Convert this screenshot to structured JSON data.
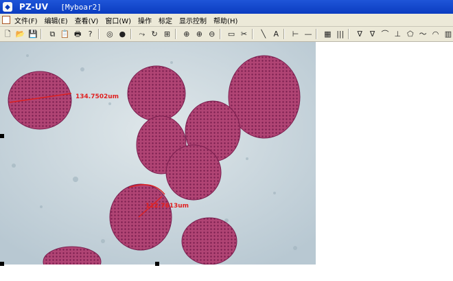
{
  "app": {
    "title": "PZ-UV",
    "document_title": "[Myboar2]"
  },
  "menu": {
    "items": [
      "文件(F)",
      "编辑(E)",
      "查看(V)",
      "窗口(W)",
      "操作",
      "标定",
      "显示控制",
      "帮助(H)"
    ]
  },
  "toolbar": {
    "groups": [
      [
        "new-file-icon",
        "open-folder-icon",
        "save-icon"
      ],
      [
        "copy-icon",
        "paste-icon",
        "print-icon",
        "help-icon"
      ],
      [
        "circle-outline-icon",
        "filled-circle-icon"
      ],
      [
        "calibrate-icon",
        "rotate-icon",
        "grid-icon"
      ],
      [
        "zoom-fit-icon",
        "zoom-in-icon",
        "zoom-out-icon"
      ],
      [
        "rectangle-icon",
        "tool-icon"
      ],
      [
        "line-icon",
        "text-icon"
      ],
      [
        "dimension-icon",
        "horizontal-line-icon"
      ],
      [
        "color-palette-icon",
        "bars-icon"
      ],
      [
        "angle-tool-icon",
        "angle-tool-2-icon",
        "arc-tool-icon",
        "baseline-icon",
        "polygon-tool-icon",
        "curve-tool-icon",
        "protractor-icon",
        "histogram-icon"
      ]
    ],
    "glyphs": {
      "new-file-icon": "🗋",
      "open-folder-icon": "📂",
      "save-icon": "💾",
      "copy-icon": "⧉",
      "paste-icon": "📋",
      "print-icon": "🖶",
      "help-icon": "?",
      "circle-outline-icon": "◎",
      "filled-circle-icon": "●",
      "calibrate-icon": "⤳",
      "rotate-icon": "↻",
      "grid-icon": "⊞",
      "zoom-fit-icon": "⊕",
      "zoom-in-icon": "⊕",
      "zoom-out-icon": "⊖",
      "rectangle-icon": "▭",
      "tool-icon": "✂",
      "line-icon": "╲",
      "text-icon": "A",
      "dimension-icon": "⊢",
      "horizontal-line-icon": "—",
      "color-palette-icon": "▦",
      "bars-icon": "|||",
      "angle-tool-icon": "∇",
      "angle-tool-2-icon": "∇",
      "arc-tool-icon": "⌒",
      "baseline-icon": "⊥",
      "polygon-tool-icon": "⬠",
      "curve-tool-icon": "〜",
      "protractor-icon": "◠",
      "histogram-icon": "▥"
    }
  },
  "measurements": [
    {
      "label": "134.7502um"
    },
    {
      "label": "112.7613um"
    }
  ],
  "colors": {
    "titlebar": "#0a3cc0",
    "chrome": "#ece9d8",
    "measure": "#e02020",
    "cell": "#b54a78",
    "background": "#c9d6de"
  }
}
